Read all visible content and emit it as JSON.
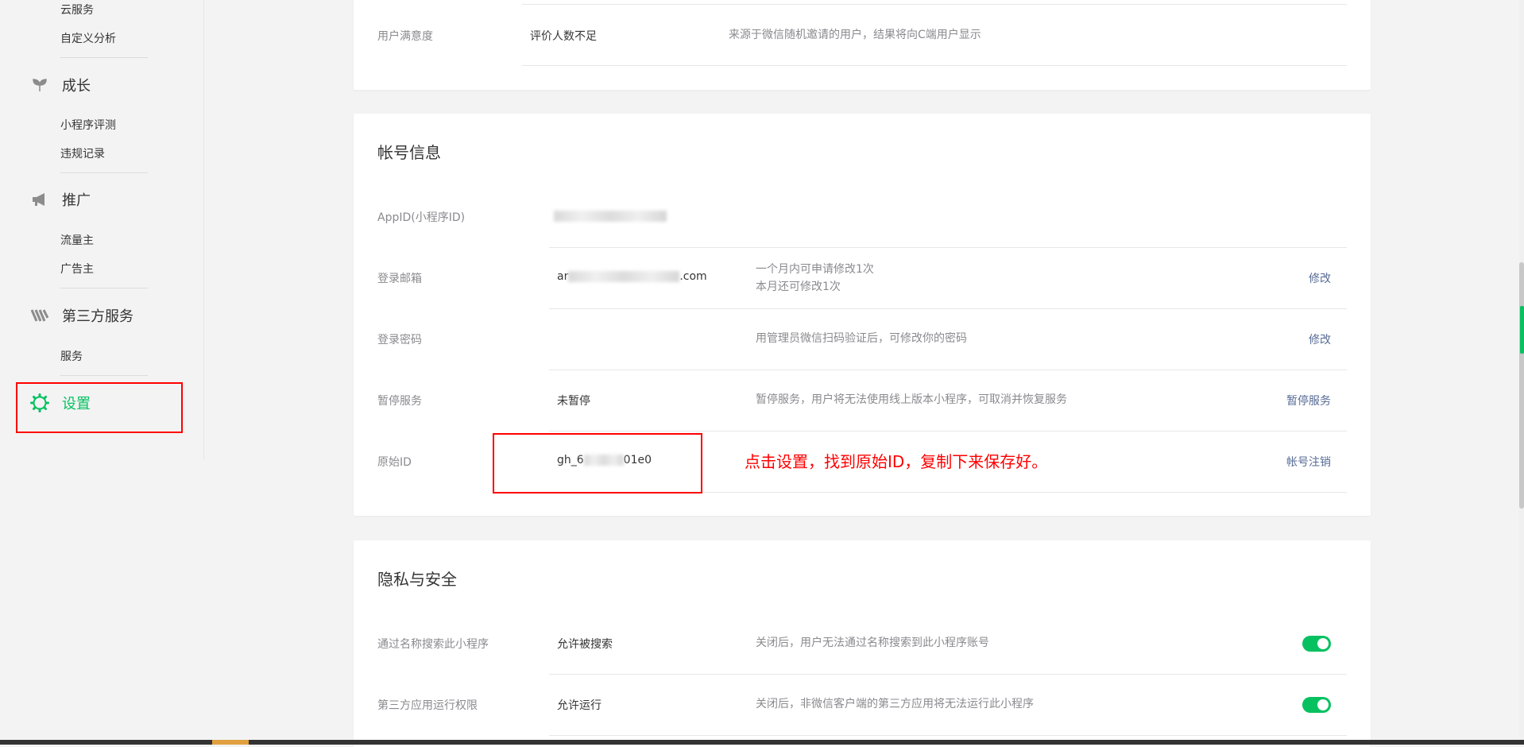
{
  "sidebar": {
    "top_items": [
      "云服务",
      "自定义分析"
    ],
    "groups": [
      {
        "icon": "sprout-icon",
        "label": "成长",
        "items": [
          "小程序评测",
          "违规记录"
        ]
      },
      {
        "icon": "megaphone-icon",
        "label": "推广",
        "items": [
          "流量主",
          "广告主"
        ]
      },
      {
        "icon": "third-party-icon",
        "label": "第三方服务",
        "items": [
          "服务"
        ]
      }
    ],
    "settings": {
      "icon": "gear-icon",
      "label": "设置"
    }
  },
  "satisfaction": {
    "label": "用户满意度",
    "value": "评价人数不足",
    "desc": "来源于微信随机邀请的用户，结果将向C端用户显示"
  },
  "account": {
    "title": "帐号信息",
    "rows": [
      {
        "label": "AppID(小程序ID)",
        "value": "",
        "desc": [],
        "action": ""
      },
      {
        "label": "登录邮箱",
        "value_prefix": "ar",
        "value_suffix": ".com",
        "desc": [
          "一个月内可申请修改1次",
          "本月还可修改1次"
        ],
        "action": "修改"
      },
      {
        "label": "登录密码",
        "value": "",
        "desc": [
          "用管理员微信扫码验证后，可修改你的密码"
        ],
        "action": "修改"
      },
      {
        "label": "暂停服务",
        "value": "未暂停",
        "desc": [
          "暂停服务，用户将无法使用线上版本小程序，可取消并恢复服务"
        ],
        "action": "暂停服务"
      },
      {
        "label": "原始ID",
        "value_prefix": "gh_6",
        "value_suffix": "01e0",
        "desc": [],
        "action": "帐号注销"
      }
    ],
    "annotation": "点击设置，找到原始ID，复制下来保存好。"
  },
  "privacy": {
    "title": "隐私与安全",
    "rows": [
      {
        "label": "通过名称搜索此小程序",
        "value": "允许被搜索",
        "desc": "关闭后，用户无法通过名称搜索到此小程序账号",
        "toggle": "on"
      },
      {
        "label": "第三方应用运行权限",
        "value": "允许运行",
        "desc": "关闭后，非微信客户端的第三方应用将无法运行此小程序",
        "toggle": "on"
      }
    ]
  },
  "colors": {
    "accent": "#07c160",
    "link": "#576b95",
    "annotation": "#ff0000"
  }
}
